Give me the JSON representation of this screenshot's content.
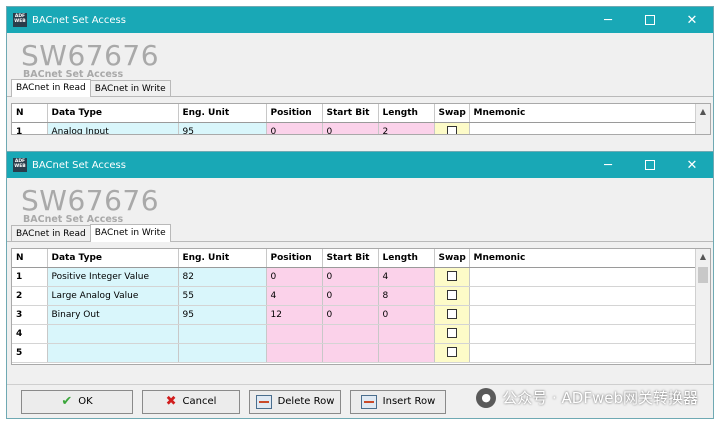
{
  "window_title": "BACnet Set Access",
  "window_controls": {
    "minimize": "─",
    "close": "✕"
  },
  "app_icon_text": "ADF WEB",
  "brand": {
    "title": "SW67676",
    "subtitle": "BACnet Set Access"
  },
  "tabs": [
    {
      "label": "BACnet in Read"
    },
    {
      "label": "BACnet in Write"
    }
  ],
  "columns": [
    "N",
    "Data Type",
    "Eng. Unit",
    "Position",
    "Start Bit",
    "Length",
    "Swap",
    "Mnemonic"
  ],
  "read_rows": [
    {
      "n": "1",
      "data_type": "Analog Input",
      "eng_unit": "95",
      "position": "0",
      "start_bit": "0",
      "length": "2",
      "swap": false,
      "mnemonic": ""
    }
  ],
  "write_rows": [
    {
      "n": "1",
      "data_type": "Positive Integer Value",
      "eng_unit": "82",
      "position": "0",
      "start_bit": "0",
      "length": "4",
      "swap": false,
      "mnemonic": ""
    },
    {
      "n": "2",
      "data_type": "Large Analog Value",
      "eng_unit": "55",
      "position": "4",
      "start_bit": "0",
      "length": "8",
      "swap": false,
      "mnemonic": ""
    },
    {
      "n": "3",
      "data_type": "Binary Out",
      "eng_unit": "95",
      "position": "12",
      "start_bit": "0",
      "length": "0",
      "swap": false,
      "mnemonic": ""
    },
    {
      "n": "4",
      "data_type": "",
      "eng_unit": "",
      "position": "",
      "start_bit": "",
      "length": "",
      "swap": false,
      "mnemonic": ""
    },
    {
      "n": "5",
      "data_type": "",
      "eng_unit": "",
      "position": "",
      "start_bit": "",
      "length": "",
      "swap": false,
      "mnemonic": ""
    }
  ],
  "buttons": {
    "ok": "OK",
    "cancel": "Cancel",
    "delete_row": "Delete Row",
    "insert_row": "Insert Row"
  },
  "watermark": "公众号 · ADFweb网关转换器",
  "colors": {
    "titlebar": "#19a8b6",
    "cyan_cell": "#d9f6fb",
    "pink_cell": "#fbd2ea",
    "yellow_cell": "#fdfbc8"
  }
}
